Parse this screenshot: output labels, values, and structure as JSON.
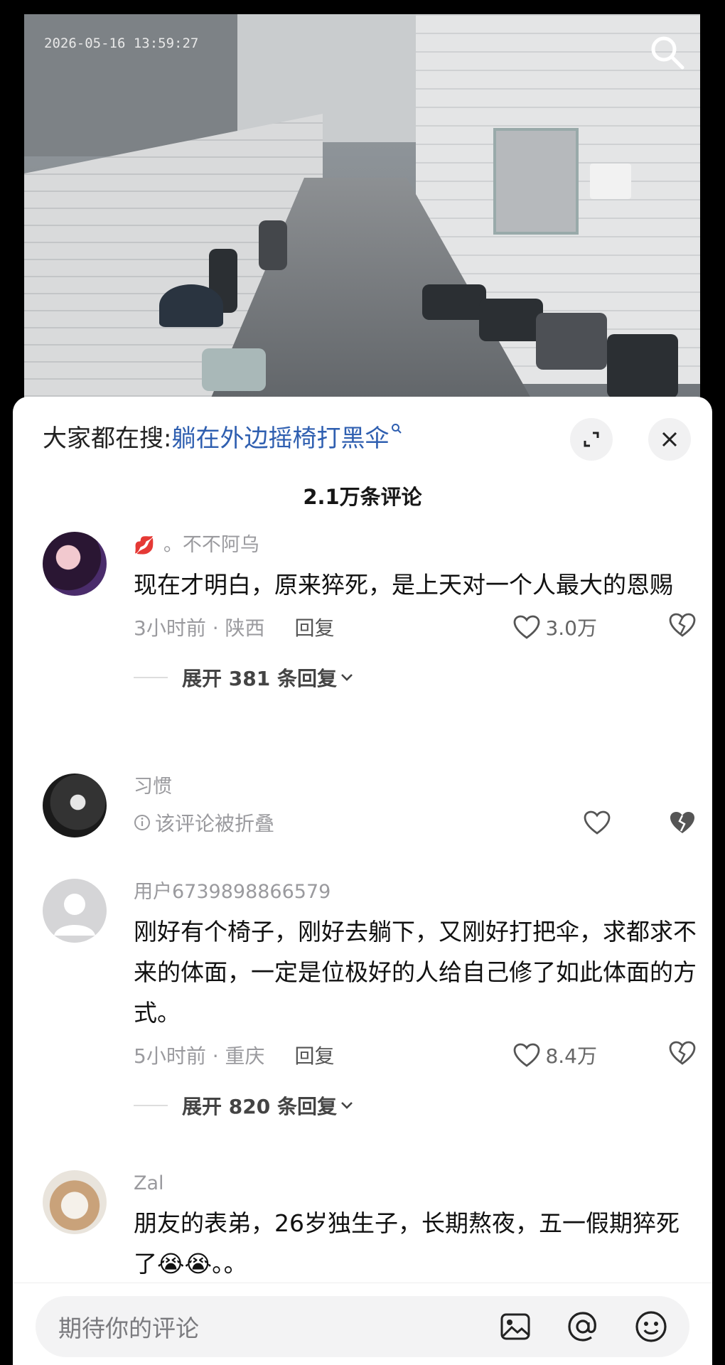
{
  "video": {
    "timestamp": "2026-05-16 13:59:27",
    "search_icon": "search-icon"
  },
  "sheet": {
    "search_prefix": "大家都在搜:",
    "search_term": "躺在外边摇椅打黑伞",
    "comment_count": "2.1万条评论"
  },
  "comments": [
    {
      "name": "。不不阿乌",
      "name_emoji": "💋",
      "text": "现在才明白，原来猝死，是上天对一个人最大的恩赐",
      "time_loc": "3小时前 · 陕西",
      "reply": "回复",
      "likes": "3.0万",
      "expand": "展开 381 条回复"
    },
    {
      "name": "习惯",
      "folded_text": "该评论被折叠"
    },
    {
      "name": "用户6739898866579",
      "text": "刚好有个椅子，刚好去躺下，又刚好打把伞，求都求不来的体面，一定是位极好的人给自己修了如此体面的方式。",
      "time_loc": "5小时前 · 重庆",
      "reply": "回复",
      "likes": "8.4万",
      "expand": "展开 820 条回复"
    },
    {
      "name": "Zal",
      "text": "朋友的表弟，26岁独生子，长期熬夜，五一假期猝死了😭😭。。"
    }
  ],
  "input": {
    "placeholder": "期待你的评论"
  },
  "colors": {
    "accent": "#2f5fb0",
    "meta_gray": "#9a9a9e"
  }
}
